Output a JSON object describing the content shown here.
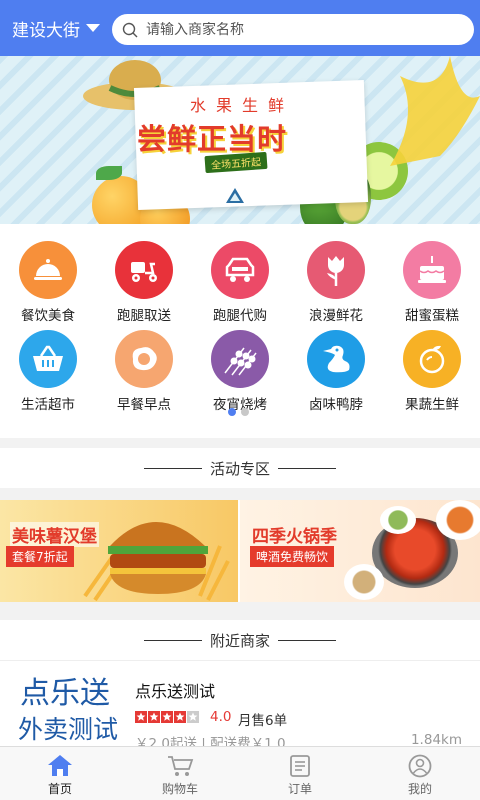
{
  "header": {
    "location": "建设大街",
    "search_placeholder": "请输入商家名称"
  },
  "banner": {
    "subtitle": "水果生鲜",
    "title": "尝鲜正当时",
    "tag": "全场五折起"
  },
  "categories": [
    {
      "label": "餐饮美食",
      "color": "#f7903a",
      "icon": "dish-cover-icon"
    },
    {
      "label": "跑腿取送",
      "color": "#e8323a",
      "icon": "scooter-icon"
    },
    {
      "label": "跑腿代购",
      "color": "#ec4a67",
      "icon": "shopping-cart-icon"
    },
    {
      "label": "浪漫鲜花",
      "color": "#e65a73",
      "icon": "rose-icon"
    },
    {
      "label": "甜蜜蛋糕",
      "color": "#f37ca3",
      "icon": "cake-icon"
    },
    {
      "label": "生活超市",
      "color": "#2da7eb",
      "icon": "basket-icon"
    },
    {
      "label": "早餐早点",
      "color": "#f6a670",
      "icon": "fried-egg-icon"
    },
    {
      "label": "夜宵烧烤",
      "color": "#8a5aa8",
      "icon": "skewer-icon"
    },
    {
      "label": "卤味鸭脖",
      "color": "#1f9de6",
      "icon": "duck-icon"
    },
    {
      "label": "果蔬生鲜",
      "color": "#f7b125",
      "icon": "orange-icon"
    }
  ],
  "pager": {
    "pages": 2,
    "active": 1
  },
  "activity": {
    "title": "活动专区",
    "promos": [
      {
        "title": "美味薯汉堡",
        "sub": "套餐7折起"
      },
      {
        "title": "四季火锅季",
        "sub": "啤酒免费畅饮"
      }
    ]
  },
  "nearby": {
    "title": "附近商家",
    "merchant": {
      "logo_line1": "点乐送",
      "logo_line2": "外卖测试",
      "name": "点乐送测试",
      "stars": 4,
      "rating": "4.0",
      "sales": "月售6单",
      "fees": "￥2.0起送 | 配送费￥1.0",
      "distance": "1.84km"
    }
  },
  "tabbar": [
    {
      "label": "首页",
      "icon": "home-icon",
      "active": true
    },
    {
      "label": "购物车",
      "icon": "cart-icon",
      "active": false
    },
    {
      "label": "订单",
      "icon": "order-icon",
      "active": false
    },
    {
      "label": "我的",
      "icon": "profile-icon",
      "active": false
    }
  ],
  "colors": {
    "primary": "#4f7ef0",
    "rating": "#e53935"
  }
}
